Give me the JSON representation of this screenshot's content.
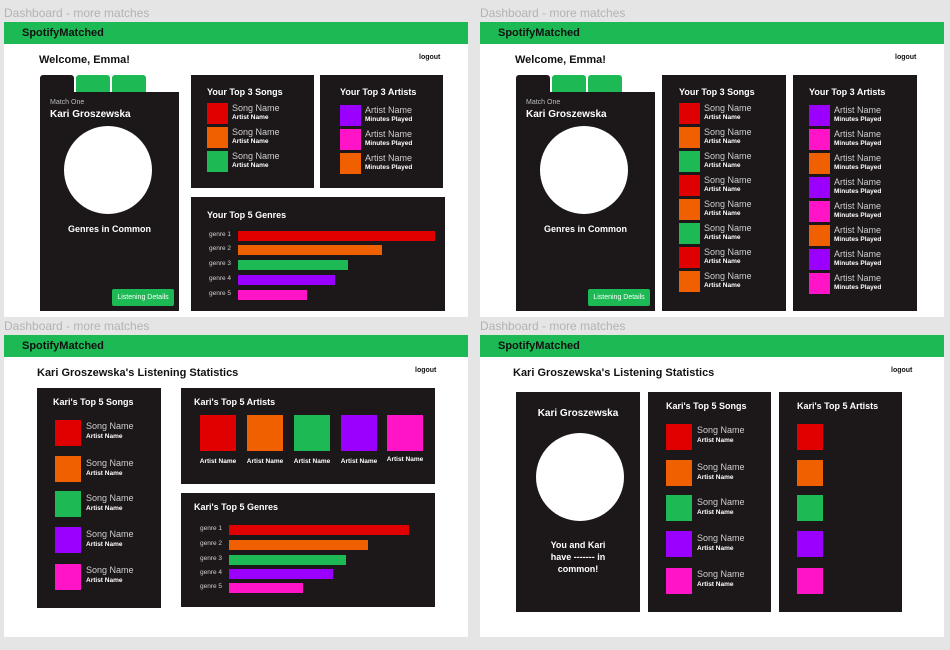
{
  "frame_label": "Dashboard - more matches",
  "app": {
    "brand": "SpotifyMatched",
    "logout": "logout"
  },
  "colors": {
    "brand": "#1db954",
    "panel": "#1c1718",
    "red": "#e00000",
    "orange": "#f06000",
    "green": "#1db954",
    "purple": "#9b00ff",
    "pink": "#ff14c8"
  },
  "dashboard": {
    "welcome": "Welcome, Emma!",
    "match_label": "Match One",
    "match_name": "Kari Groszewska",
    "genres_common": "Genres in Common",
    "details_button": "Listening Details",
    "top3_songs_title": "Your Top 3 Songs",
    "top3_artists_title": "Your Top 3 Artists",
    "top5_genres_title": "Your Top 5 Genres",
    "song_name": "Song Name",
    "artist_name": "Artist Name",
    "minutes_played": "Minutes Played",
    "genres": [
      "genre 1",
      "genre 2",
      "genre 3",
      "genre 4",
      "genre 5"
    ],
    "genre_levels": [
      1.0,
      0.73,
      0.56,
      0.49,
      0.35
    ]
  },
  "stats": {
    "title": "Kari Groszewska's Listening Statistics",
    "top5_songs_title": "Kari's Top 5 Songs",
    "top5_artists_title": "Kari's Top 5 Artists",
    "top5_genres_title": "Kari's Top 5 Genres",
    "song_name": "Song Name",
    "artist_name": "Artist Name",
    "genres": [
      "genre 1",
      "genre 2",
      "genre 3",
      "genre 4",
      "genre 5"
    ],
    "genre_levels": [
      1.0,
      0.77,
      0.65,
      0.58,
      0.41
    ],
    "profile_name": "Kari Groszewska",
    "in_common": "You and Kari have ------- in common!"
  }
}
